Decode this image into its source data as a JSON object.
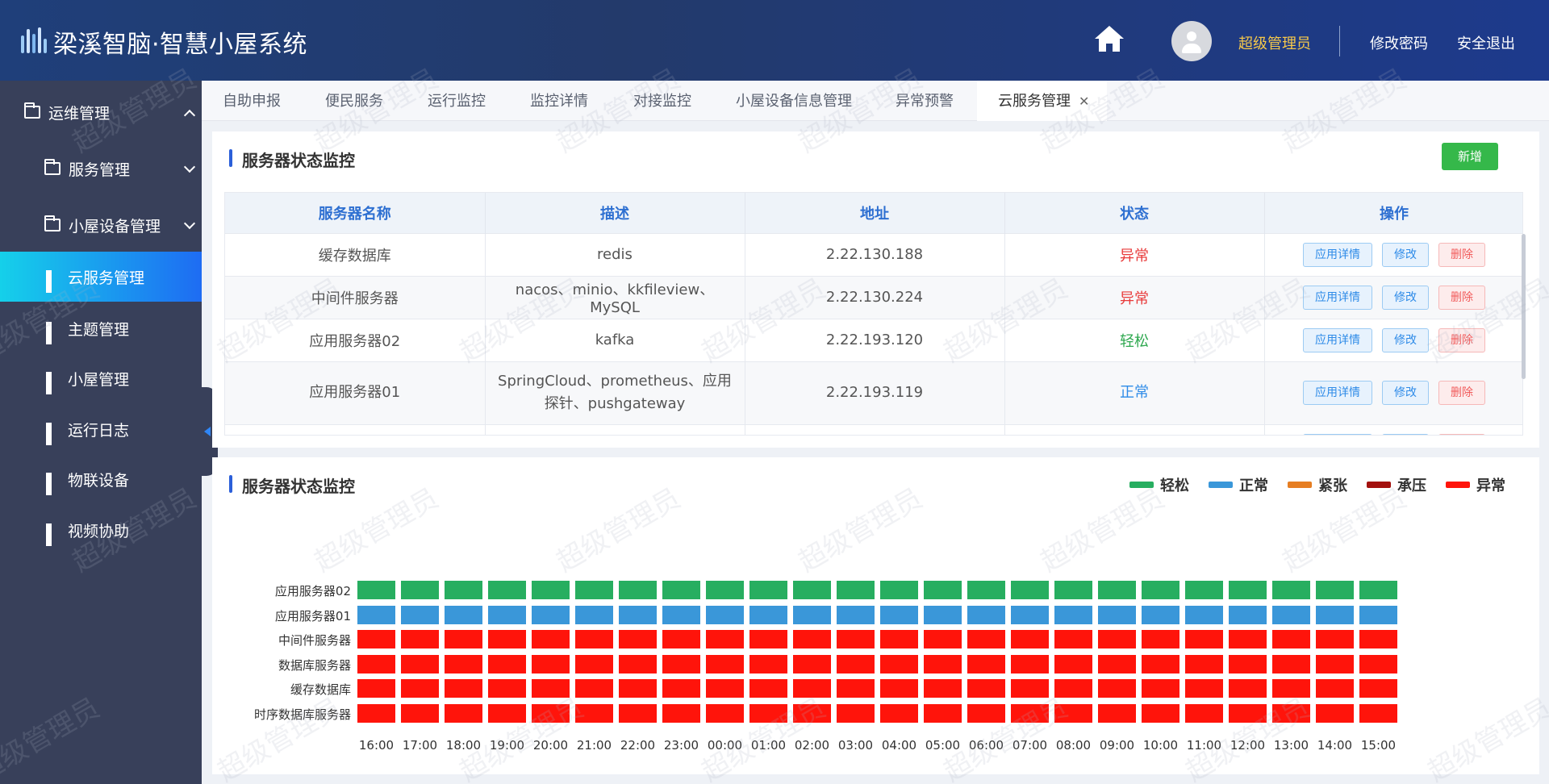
{
  "header": {
    "app_title": "梁溪智脑·智慧小屋系统",
    "user_name": "超级管理员",
    "change_password": "修改密码",
    "logout": "安全退出"
  },
  "sidebar": {
    "items": [
      {
        "label": "运维管理",
        "icon": "folder-icon",
        "expand": "up"
      },
      {
        "label": "服务管理",
        "icon": "folder-icon",
        "expand": "down"
      },
      {
        "label": "小屋设备管理",
        "icon": "folder-icon",
        "expand": "down"
      },
      {
        "label": "云服务管理",
        "icon": "grid-icon",
        "active": true
      },
      {
        "label": "主题管理",
        "icon": "grid-icon"
      },
      {
        "label": "小屋管理",
        "icon": "grid-icon"
      },
      {
        "label": "运行日志",
        "icon": "grid-icon"
      },
      {
        "label": "物联设备",
        "icon": "grid-icon"
      },
      {
        "label": "视频协助",
        "icon": "grid-icon"
      }
    ]
  },
  "tabs": [
    "自助申报",
    "便民服务",
    "运行监控",
    "监控详情",
    "对接监控",
    "小屋设备信息管理",
    "异常预警",
    "云服务管理"
  ],
  "active_tab": "云服务管理",
  "panel_top": {
    "title": "服务器状态监控",
    "add_button": "新增",
    "columns": [
      "服务器名称",
      "描述",
      "地址",
      "状态",
      "操作"
    ],
    "rows": [
      {
        "name": "缓存数据库",
        "desc": "redis",
        "addr": "2.22.130.188",
        "status": "异常",
        "status_color": "#e83a3a"
      },
      {
        "name": "中间件服务器",
        "desc": "nacos、minio、kkfileview、MySQL",
        "addr": "2.22.130.224",
        "status": "异常",
        "status_color": "#e83a3a"
      },
      {
        "name": "应用服务器02",
        "desc": "kafka",
        "addr": "2.22.193.120",
        "status": "轻松",
        "status_color": "#2ea84f"
      },
      {
        "name": "应用服务器01",
        "desc": "SpringCloud、prometheus、应用探针、pushgateway",
        "addr": "2.22.193.119",
        "status": "正常",
        "status_color": "#2e8be8"
      }
    ],
    "op_labels": {
      "detail": "应用详情",
      "edit": "修改",
      "delete": "删除"
    }
  },
  "panel_bottom": {
    "title": "服务器状态监控"
  },
  "colors": {
    "轻松": "#27ae60",
    "正常": "#3a97d9",
    "紧张": "#e67e22",
    "承压": "#a3110e",
    "异常": "#ff140b"
  },
  "chart_data": {
    "type": "heatmap",
    "legend": [
      "轻松",
      "正常",
      "紧张",
      "承压",
      "异常"
    ],
    "y_categories": [
      "应用服务器02",
      "应用服务器01",
      "中间件服务器",
      "数据库服务器",
      "缓存数据库",
      "时序数据库服务器"
    ],
    "x_categories": [
      "16:00",
      "17:00",
      "18:00",
      "19:00",
      "20:00",
      "21:00",
      "22:00",
      "23:00",
      "00:00",
      "01:00",
      "02:00",
      "03:00",
      "04:00",
      "05:00",
      "06:00",
      "07:00",
      "08:00",
      "09:00",
      "10:00",
      "11:00",
      "12:00",
      "13:00",
      "14:00",
      "15:00"
    ],
    "row_status": [
      "轻松",
      "正常",
      "异常",
      "异常",
      "异常",
      "异常"
    ]
  },
  "watermark": "超级管理员"
}
